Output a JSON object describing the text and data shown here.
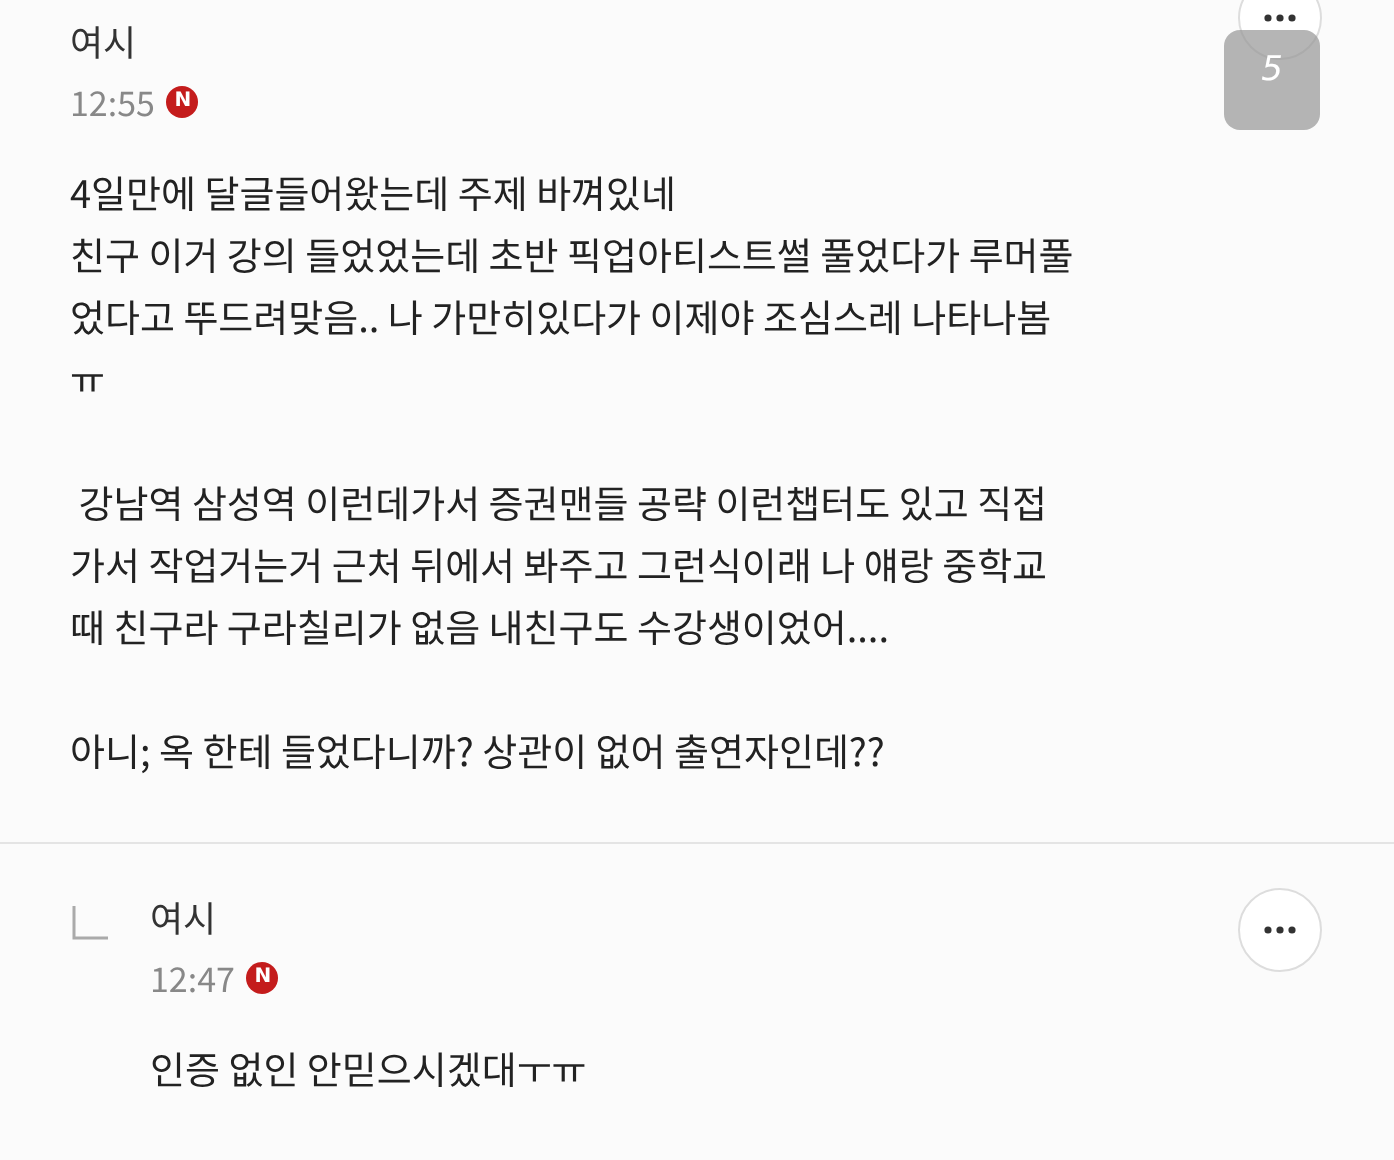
{
  "comments": [
    {
      "kind": "comment",
      "author": "여시",
      "time": "12:55",
      "badge": "N",
      "page_badge": "5",
      "paragraphs": [
        {
          "lines": [
            "4일만에 달글들어왔는데 주제 바껴있네",
            "친구 이거 강의 들었었는데 초반 픽업아티스트썰 풀었다가 루머풀",
            "었다고 뚜드려맞음.. 나 가만히있다가 이제야 조심스레 나타나봄",
            "ㅠ"
          ]
        },
        {
          "lines": [
            " 강남역 삼성역 이런데가서 증권맨들 공략 이런챕터도 있고 직접",
            "가서 작업거는거 근처 뒤에서 봐주고 그런식이래 나 얘랑 중학교",
            "때 친구라 구라칠리가 없음 내친구도 수강생이었어...."
          ]
        },
        {
          "lines": [
            "아니; 옥 한테 들었다니까? 상관이 없어 출연자인데??"
          ]
        }
      ]
    },
    {
      "kind": "reply",
      "author": "여시",
      "time": "12:47",
      "badge": "N",
      "paragraphs": [
        {
          "lines": [
            "인증 없인 안믿으시겠대ㅜㅠ"
          ]
        }
      ]
    }
  ]
}
